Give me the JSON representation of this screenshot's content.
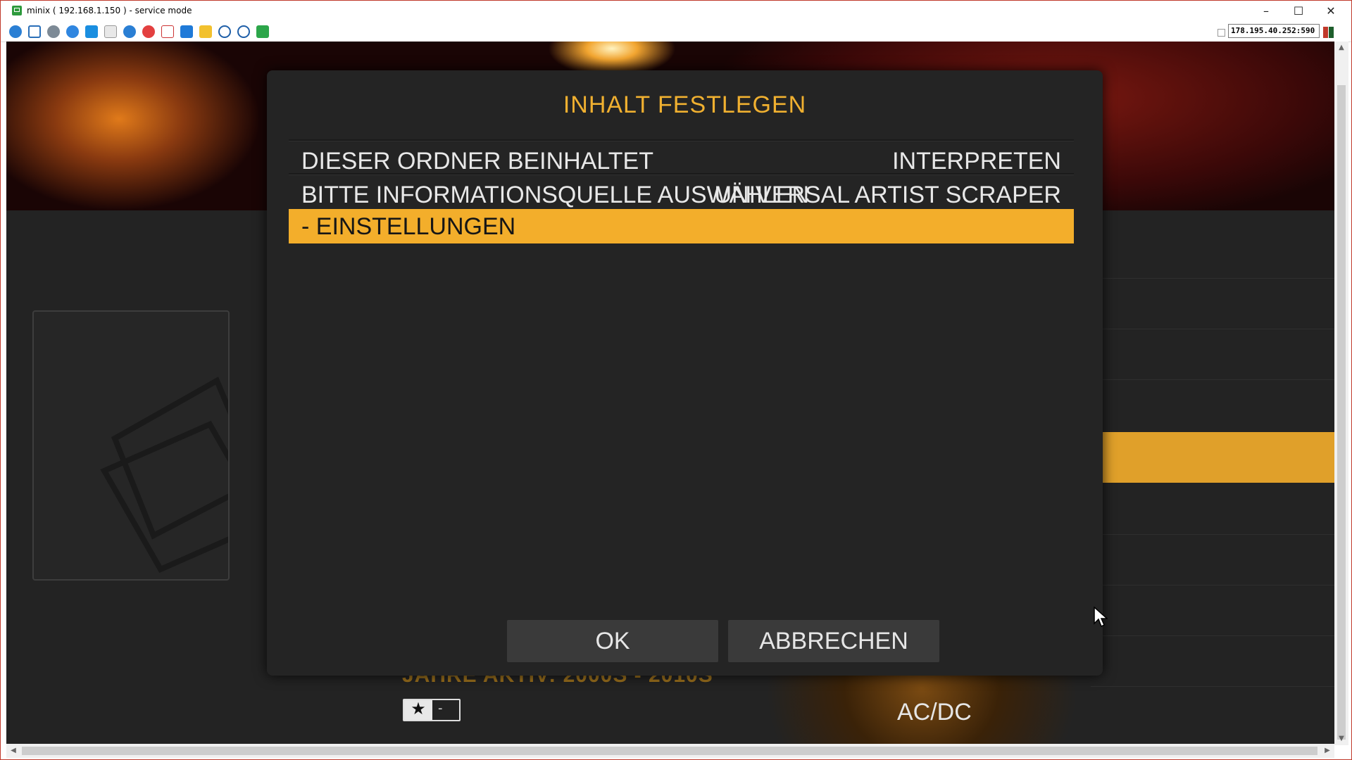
{
  "window": {
    "title": "minix ( 192.168.1.150 ) - service mode",
    "controls": {
      "minimize": "–",
      "maximize": "☐",
      "close": "✕"
    },
    "address": "178.195.40.252:590"
  },
  "toolbar": {
    "icons": [
      "refresh-connection-icon",
      "fullscreen-icon",
      "settings-icon",
      "reconnect-icon",
      "windows-icon",
      "file-transfer-icon",
      "info-icon",
      "disconnect-icon",
      "clipboard-icon",
      "folder-icon",
      "monitor-icon",
      "screenshot-icon",
      "chat-icon"
    ]
  },
  "dialog": {
    "title": "INHALT FESTLEGEN",
    "rows": [
      {
        "label": "DIESER ORDNER BEINHALTET",
        "value": "INTERPRETEN"
      },
      {
        "label": "BITTE INFORMATIONSQUELLE AUSWÄHLEN",
        "value": "UNIVERSAL ARTIST SCRAPER"
      },
      {
        "label": "- EINSTELLUNGEN",
        "value": ""
      }
    ],
    "buttons": {
      "ok": "OK",
      "cancel": "ABBRECHEN"
    }
  },
  "background": {
    "years_active": "JAHRE AKTIV: 2000S - 2010S",
    "rating_value": "-",
    "artist": "AC/DC"
  },
  "colors": {
    "accent": "#f3ae2b",
    "dialog_bg": "#242424"
  }
}
